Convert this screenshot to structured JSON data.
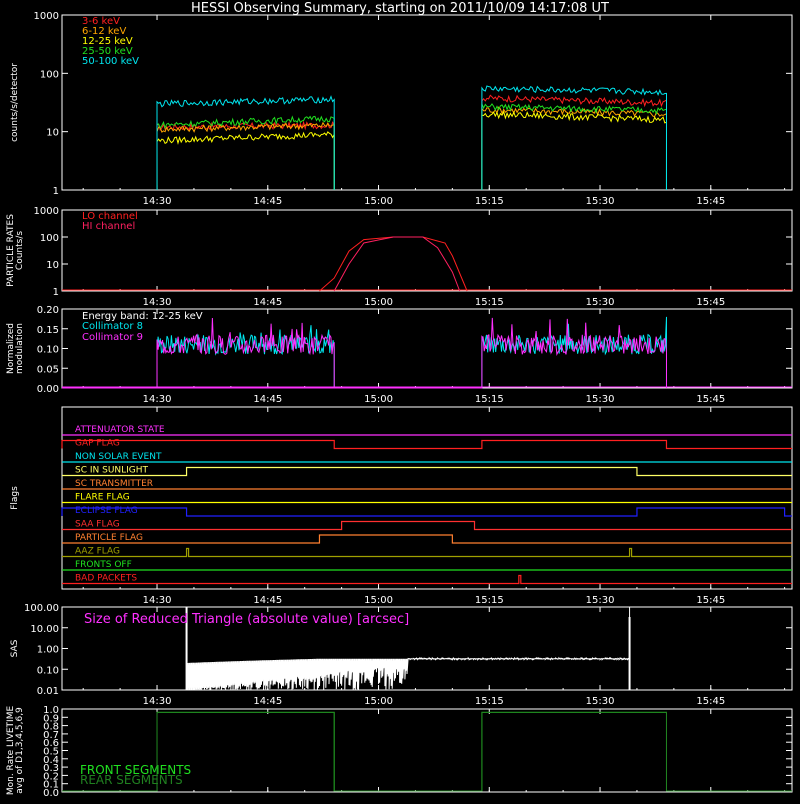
{
  "title": "HESSI Observing Summary, starting on 2011/10/09 14:17:08 UT",
  "time_ticks": [
    "14:30",
    "14:45",
    "15:00",
    "15:15",
    "15:30",
    "15:45"
  ],
  "chart_data": [
    {
      "type": "line",
      "ylabel": "counts/s/detector",
      "yscale": "log",
      "ylim": [
        1,
        1000
      ],
      "yticks": [
        "1",
        "10",
        "100",
        "1000"
      ],
      "grid": false,
      "legend_position": "top-left",
      "series": [
        {
          "name": "3-6 keV",
          "color": "#ff2020",
          "values_segment1": [
            12,
            13
          ],
          "values_segment2": [
            38,
            31
          ]
        },
        {
          "name": "6-12 keV",
          "color": "#ffa500",
          "values_segment1": [
            11,
            13
          ],
          "values_segment2": [
            24,
            20
          ]
        },
        {
          "name": "12-25 keV",
          "color": "#ffff00",
          "values_segment1": [
            7,
            9
          ],
          "values_segment2": [
            20,
            16
          ]
        },
        {
          "name": "25-50 keV",
          "color": "#20e020",
          "values_segment1": [
            13,
            17
          ],
          "values_segment2": [
            27,
            23
          ]
        },
        {
          "name": "50-100 keV",
          "color": "#00e5ee",
          "values_segment1": [
            30,
            36
          ],
          "values_segment2": [
            55,
            48
          ]
        }
      ],
      "segments": [
        [
          "14:30",
          "14:54"
        ],
        [
          "15:14",
          "15:39"
        ]
      ]
    },
    {
      "type": "line",
      "ylabel": "PARTICLE RATES Counts/s",
      "yscale": "log",
      "ylim": [
        1,
        1000
      ],
      "yticks": [
        "1",
        "10",
        "100",
        "1000"
      ],
      "legend_position": "top-left",
      "series": [
        {
          "name": "LO channel",
          "color": "#ff2020",
          "points": [
            [
              "14:52",
              1
            ],
            [
              "14:54",
              3
            ],
            [
              "14:56",
              30
            ],
            [
              "14:58",
              80
            ],
            [
              "15:02",
              100
            ],
            [
              "15:06",
              100
            ],
            [
              "15:09",
              60
            ],
            [
              "15:10",
              20
            ],
            [
              "15:12",
              1
            ]
          ]
        },
        {
          "name": "HI channel",
          "color": "#ff2060",
          "points": [
            [
              "14:54",
              1
            ],
            [
              "14:56",
              10
            ],
            [
              "14:58",
              60
            ],
            [
              "15:02",
              100
            ],
            [
              "15:06",
              100
            ],
            [
              "15:08",
              40
            ],
            [
              "15:10",
              5
            ],
            [
              "15:11",
              1
            ]
          ]
        }
      ]
    },
    {
      "type": "line",
      "ylabel": "Normalized modulation",
      "ylim": [
        0.0,
        0.2
      ],
      "yticks": [
        "0.00",
        "0.05",
        "0.10",
        "0.15",
        "0.20"
      ],
      "legend_position": "top-left",
      "annotation": "Energy band: 12-25 keV",
      "series": [
        {
          "name": "Collimator 8",
          "color": "#00e5ee",
          "mean": 0.11
        },
        {
          "name": "Collimator 9",
          "color": "#ff30ff",
          "mean": 0.11
        }
      ],
      "segments": [
        [
          "14:30",
          "14:54"
        ],
        [
          "15:14",
          "15:39"
        ]
      ]
    },
    {
      "type": "line",
      "ylabel": "Flags",
      "flags": [
        {
          "name": "ATTENUATOR STATE",
          "color": "#ff30ff",
          "high": []
        },
        {
          "name": "GAP FLAG",
          "color": "#ff2020",
          "high": [
            [
              "14:17",
              "14:54"
            ],
            [
              "15:14",
              "15:39"
            ]
          ]
        },
        {
          "name": "NON SOLAR EVENT",
          "color": "#00e5ee",
          "high": []
        },
        {
          "name": "SC IN SUNLIGHT",
          "color": "#ffff66",
          "high": [
            [
              "14:34",
              "15:35"
            ]
          ]
        },
        {
          "name": "SC TRANSMITTER",
          "color": "#ff8030",
          "high": []
        },
        {
          "name": "FLARE FLAG",
          "color": "#ffff00",
          "high": []
        },
        {
          "name": "ECLIPSE FLAG",
          "color": "#2020ff",
          "high": [
            [
              "14:17",
              "14:34"
            ],
            [
              "15:35",
              "15:55"
            ]
          ]
        },
        {
          "name": "SAA FLAG",
          "color": "#ff3030",
          "high": [
            [
              "14:55",
              "15:13"
            ]
          ]
        },
        {
          "name": "PARTICLE FLAG",
          "color": "#ff8030",
          "high": [
            [
              "14:52",
              "15:10"
            ]
          ]
        },
        {
          "name": "AAZ FLAG",
          "color": "#a0a000",
          "pulses": [
            "14:34",
            "15:34"
          ]
        },
        {
          "name": "FRONTS OFF",
          "color": "#20e020",
          "high": []
        },
        {
          "name": "BAD PACKETS",
          "color": "#ff2020",
          "pulses": [
            "15:19"
          ]
        }
      ]
    },
    {
      "type": "line",
      "ylabel": "SAS",
      "yscale": "log",
      "ylim": [
        0.01,
        100
      ],
      "yticks": [
        "0.01",
        "0.10",
        "1.00",
        "10.00",
        "100.00"
      ],
      "annotation": "Size of Reduced Triangle (absolute value) [arcsec]",
      "series": [
        {
          "name": "",
          "color": "#ffffff",
          "points": [
            [
              "14:34",
              100
            ],
            [
              "14:34",
              0.2
            ],
            [
              "14:45",
              0.2
            ],
            [
              "14:55",
              0.3
            ],
            [
              "15:00",
              0.35
            ],
            [
              "15:15",
              0.32
            ],
            [
              "15:33",
              0.3
            ],
            [
              "15:34",
              100
            ]
          ]
        }
      ]
    },
    {
      "type": "line",
      "ylabel": "Mon. Rate LIVETIME avg of D1,3,4,5,6,9",
      "ylim": [
        0.0,
        1.0
      ],
      "yticks": [
        "0.0",
        "0.1",
        "0.2",
        "0.3",
        "0.4",
        "0.5",
        "0.6",
        "0.7",
        "0.8",
        "0.9",
        "1.0"
      ],
      "legend_position": "bottom-left",
      "series": [
        {
          "name": "FRONT SEGMENTS",
          "color": "#20e020",
          "value": 0.96
        },
        {
          "name": "REAR SEGMENTS",
          "color": "#208020",
          "value": 0.96
        }
      ],
      "segments": [
        [
          "14:30",
          "14:54"
        ],
        [
          "15:14",
          "15:39"
        ]
      ]
    }
  ]
}
